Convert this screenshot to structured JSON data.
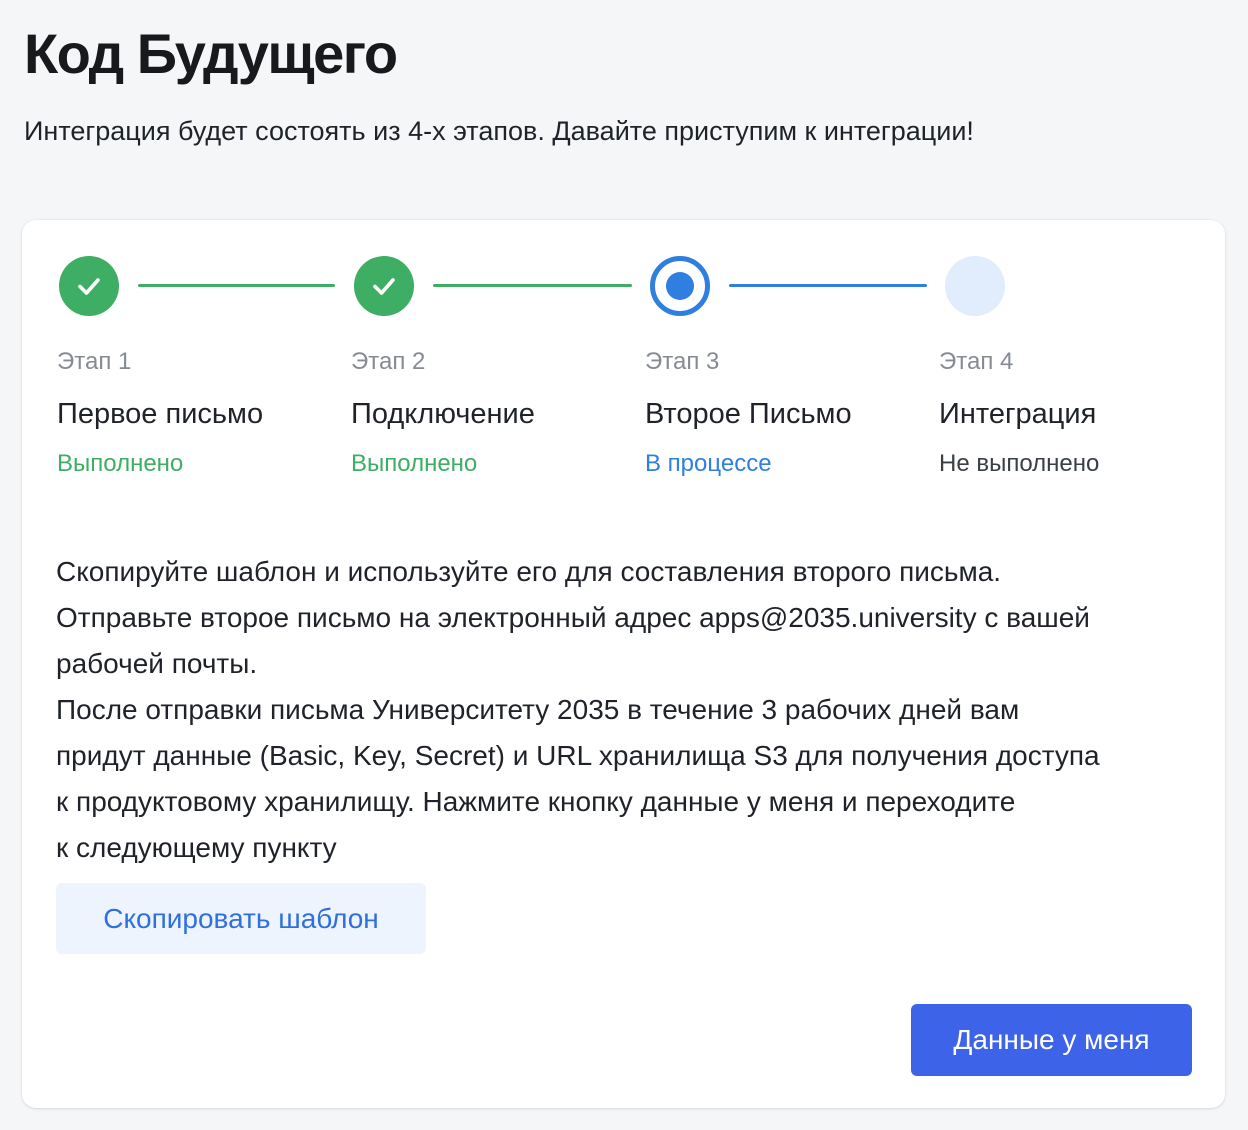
{
  "header": {
    "title": "Код Будущего",
    "subtitle": "Интеграция будет состоять из 4-х этапов. Давайте приступим к интеграции!"
  },
  "steps": [
    {
      "number": "Этап 1",
      "title": "Первое письмо",
      "status": "Выполнено",
      "state": "done"
    },
    {
      "number": "Этап 2",
      "title": "Подключение",
      "status": "Выполнено",
      "state": "done"
    },
    {
      "number": "Этап 3",
      "title": "Второе Письмо",
      "status": "В процессе",
      "state": "active"
    },
    {
      "number": "Этап 4",
      "title": "Интеграция",
      "status": "Не выполнено",
      "state": "todo"
    }
  ],
  "description": {
    "lines": [
      "Скопируйте шаблон и используйте его для составления второго письма.",
      "Отправьте второе письмо на электронный адрес apps@2035.university с вашей",
      "рабочей почты.",
      "После отправки письма Университету 2035 в течение 3 рабочих дней вам",
      "придут данные (Basic, Key, Secret) и URL хранилища S3 для получения доступа",
      "к продуктовому хранилищу. Нажмите кнопку данные у меня и переходите",
      "к следующему пункту"
    ]
  },
  "actions": {
    "copy_template_label": "Скопировать шаблон",
    "have_data_label": "Данные у меня"
  },
  "colors": {
    "done": "#3dae63",
    "active": "#2f7fe0",
    "todo": "#e1edfc",
    "primary_button": "#3d63e8",
    "secondary_button": "#eef4fd"
  },
  "icons": {
    "done": "check-icon",
    "active": "radio-active-icon",
    "todo": "circle-empty-icon"
  }
}
